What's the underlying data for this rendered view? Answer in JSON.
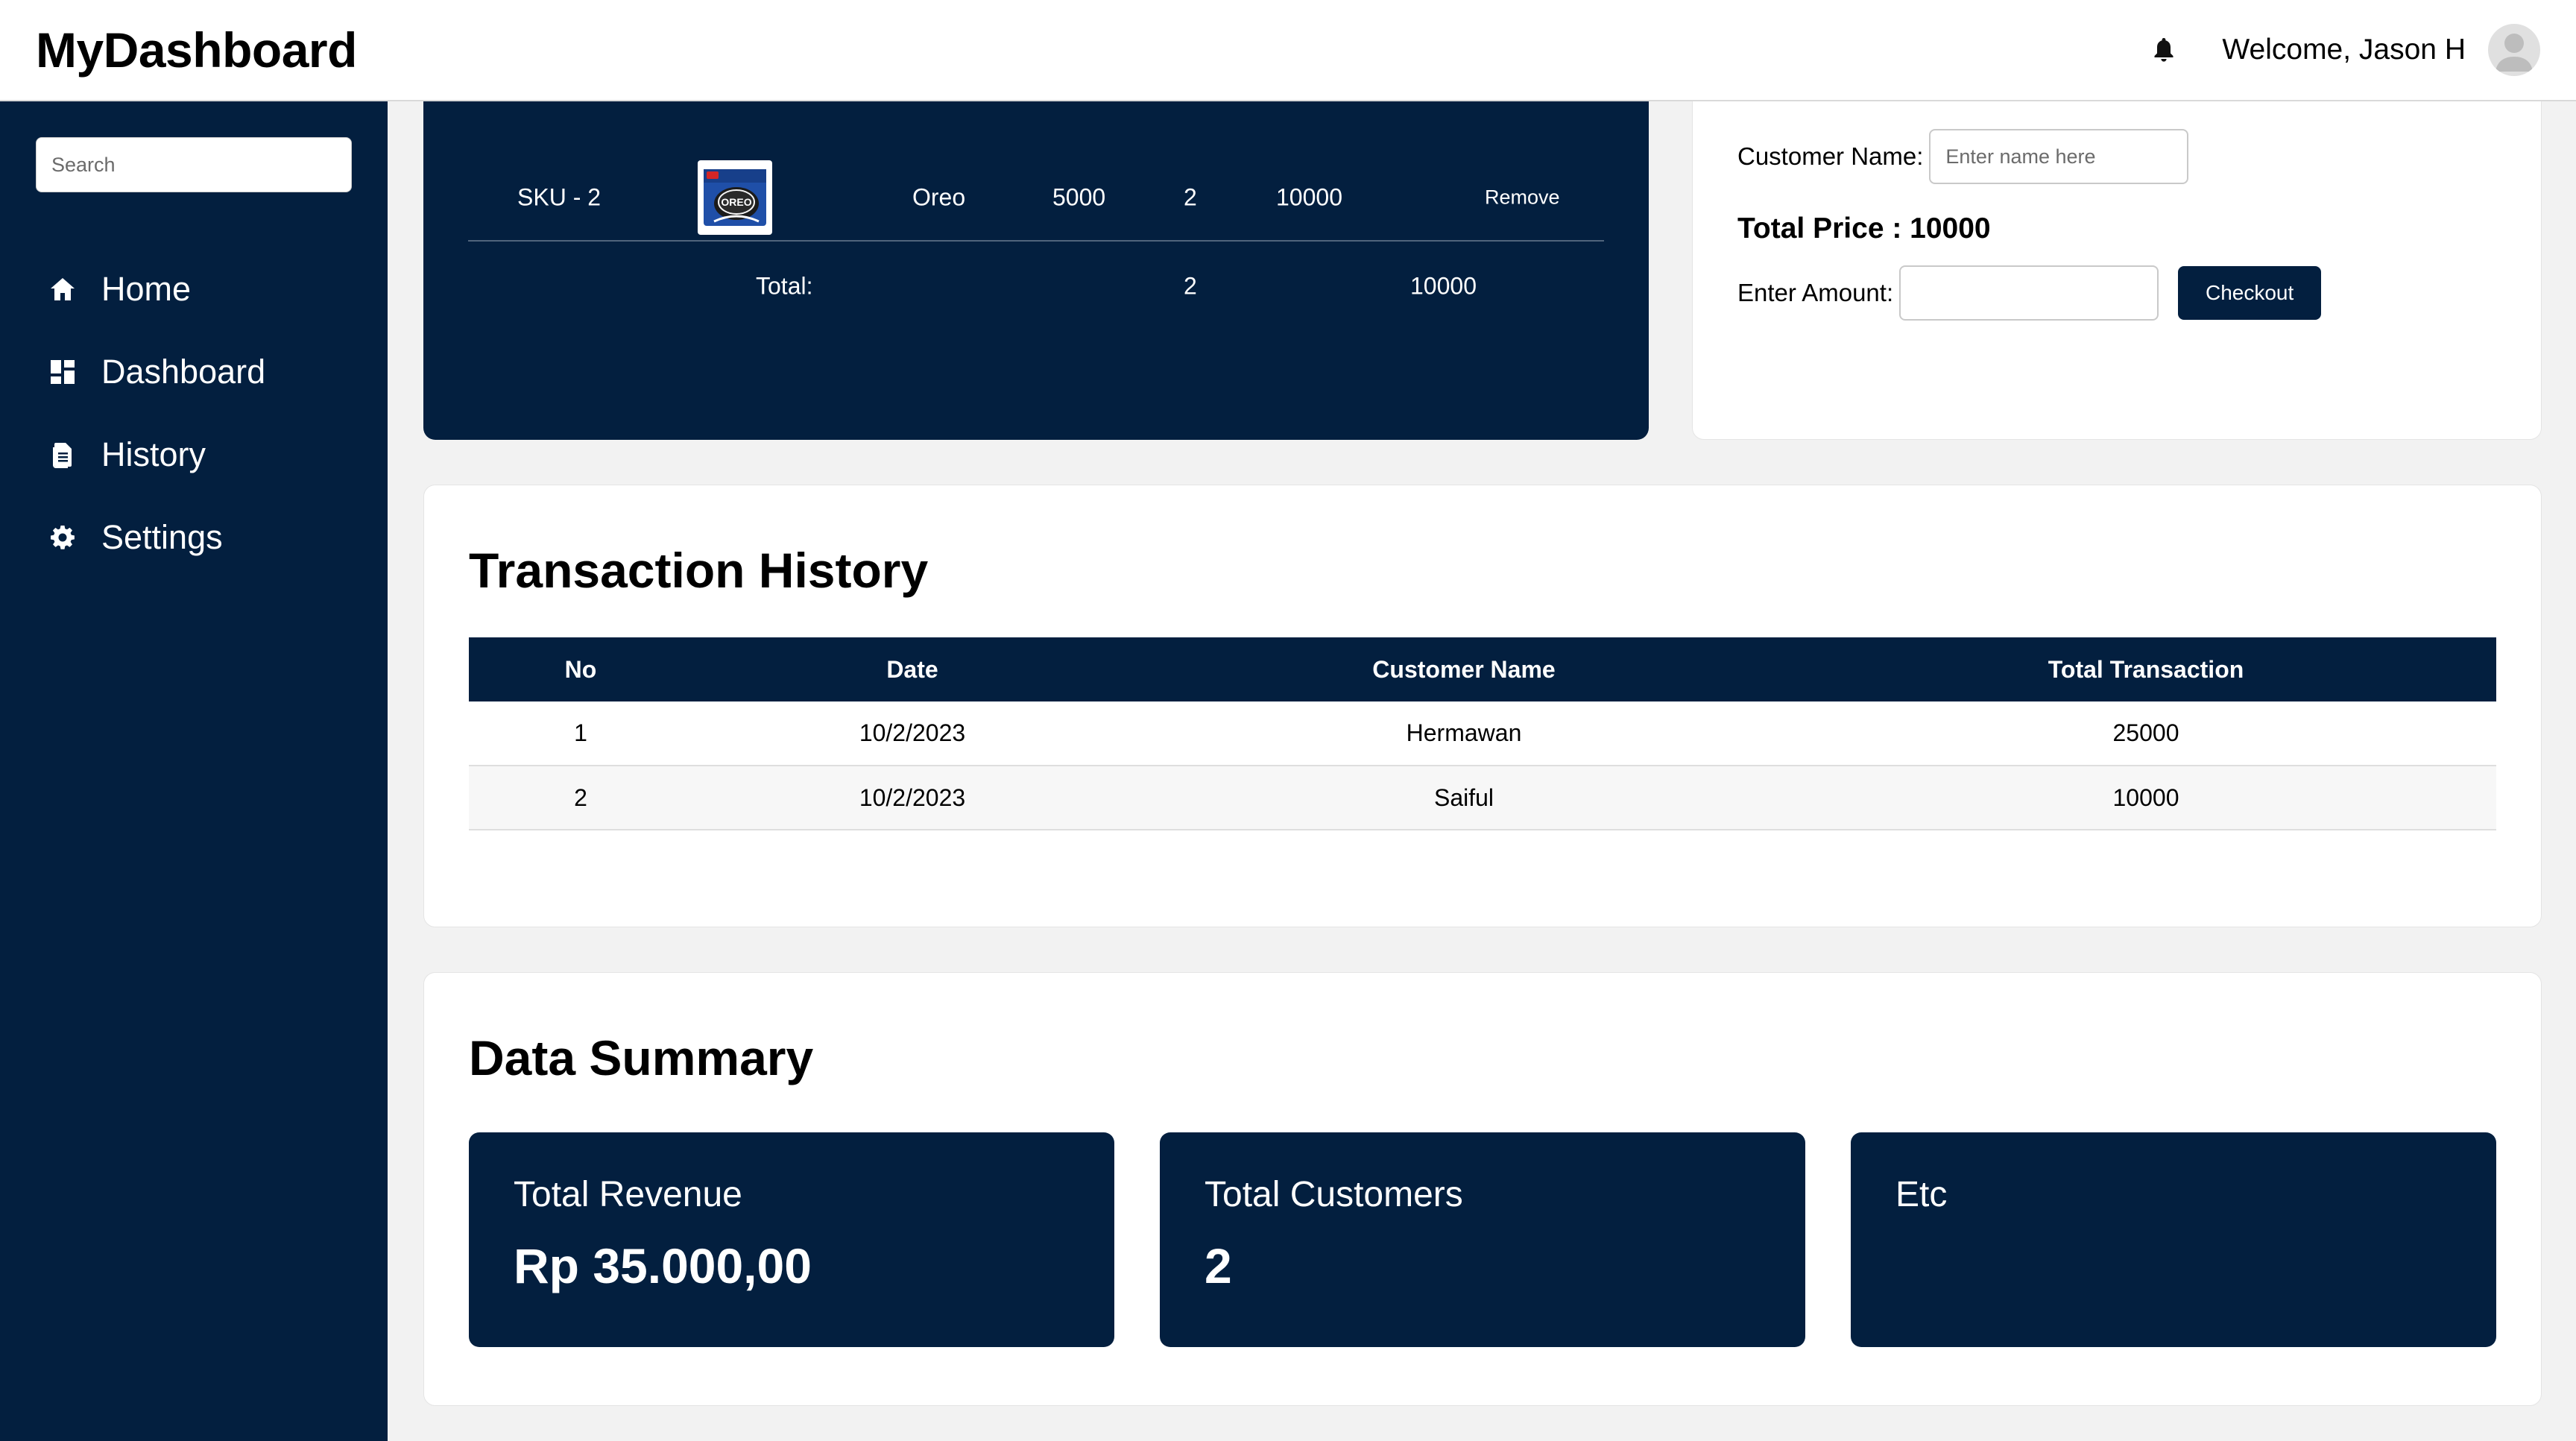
{
  "header": {
    "brand": "MyDashboard",
    "welcome": "Welcome, Jason H",
    "icons": [
      "bell-icon",
      "user-avatar-icon"
    ]
  },
  "sidebar": {
    "search_placeholder": "Search",
    "items": [
      {
        "label": "Home",
        "icon": "home-icon"
      },
      {
        "label": "Dashboard",
        "icon": "dashboard-grid-icon"
      },
      {
        "label": "History",
        "icon": "document-icon"
      },
      {
        "label": "Settings",
        "icon": "gear-icon"
      }
    ]
  },
  "cart": {
    "row": {
      "sku": "SKU - 2",
      "product_image": "oreo-product-image",
      "name": "Oreo",
      "price": "5000",
      "qty": "2",
      "subtotal": "10000",
      "action": "Remove"
    },
    "total": {
      "label": "Total:",
      "qty": "2",
      "sum": "10000"
    }
  },
  "checkout": {
    "customer_label": "Customer Name:",
    "customer_placeholder": "Enter name here",
    "total_price": "Total Price : 10000",
    "amount_label": "Enter Amount:",
    "amount_value": "",
    "button": "Checkout"
  },
  "history": {
    "title": "Transaction History",
    "columns": [
      "No",
      "Date",
      "Customer Name",
      "Total Transaction"
    ],
    "rows": [
      [
        "1",
        "10/2/2023",
        "Hermawan",
        "25000"
      ],
      [
        "2",
        "10/2/2023",
        "Saiful",
        "10000"
      ]
    ]
  },
  "summary": {
    "title": "Data Summary",
    "cards": [
      {
        "label": "Total Revenue",
        "value": "Rp 35.000,00"
      },
      {
        "label": "Total Customers",
        "value": "2"
      },
      {
        "label": "Etc",
        "value": ""
      }
    ]
  },
  "colors": {
    "navy": "#031f3f",
    "background": "#f2f2f2",
    "white": "#ffffff"
  }
}
